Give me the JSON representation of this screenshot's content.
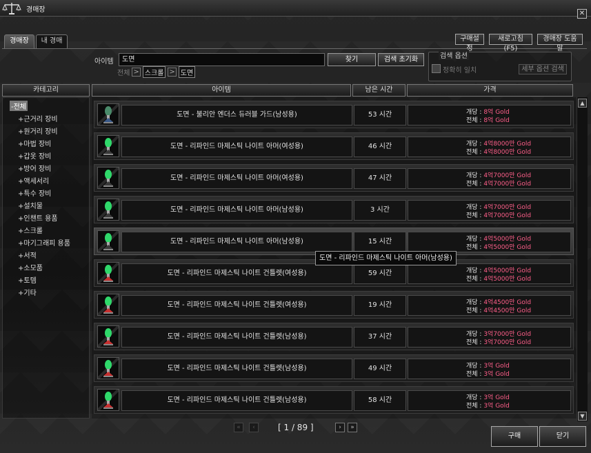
{
  "window": {
    "title": "경매장"
  },
  "tabs": [
    {
      "label": "경매장",
      "active": true
    },
    {
      "label": "내 경매",
      "active": false
    }
  ],
  "toolbar": {
    "purchase_settings": "구매설정",
    "refresh": "새로고침(F5)",
    "help": "경매장 도움말"
  },
  "search": {
    "item_label": "아이템",
    "item_value": "도면",
    "find_button": "찾기",
    "reset_button": "검색 초기화",
    "breadcrumb": [
      "전체",
      "스크롤",
      "도면"
    ],
    "options_title": "검색 옵션",
    "exact_match_label": "정확히 일치",
    "detail_search_button": "세부 옵션 검색"
  },
  "headers": {
    "category": "카테고리",
    "item": "아이템",
    "time_left": "남은 시간",
    "price": "가격"
  },
  "categories": [
    {
      "label": "-전체",
      "selected": true,
      "indent": 0
    },
    {
      "label": "+근거리 장비",
      "indent": 1
    },
    {
      "label": "+원거리 장비",
      "indent": 1
    },
    {
      "label": "+마법 장비",
      "indent": 1
    },
    {
      "label": "+갑옷 장비",
      "indent": 1
    },
    {
      "label": "+방어 장비",
      "indent": 1
    },
    {
      "label": "+액세서리",
      "indent": 1
    },
    {
      "label": "+특수 장비",
      "indent": 1
    },
    {
      "label": "+설치물",
      "indent": 1
    },
    {
      "label": "+인챈트 용품",
      "indent": 1
    },
    {
      "label": "+스크롤",
      "indent": 1
    },
    {
      "label": "+마기그래피 용품",
      "indent": 1
    },
    {
      "label": "+서적",
      "indent": 1
    },
    {
      "label": "+소모품",
      "indent": 1
    },
    {
      "label": "+토템",
      "indent": 1
    },
    {
      "label": "+기타",
      "indent": 1
    }
  ],
  "price_labels": {
    "each": "개당 : ",
    "total": "전체 : "
  },
  "items": [
    {
      "name": "도면 - 불리안 엔더스 듀러블 가드(남성용)",
      "time": "53 시간",
      "each": "8억 Gold",
      "total": "8억 Gold",
      "icon": "blueprint-dark-icon"
    },
    {
      "name": "도면 - 리파인드 마제스틱 나이트 아머(여성용)",
      "time": "46 시간",
      "each": "4억8000만 Gold",
      "total": "4억8000만 Gold",
      "icon": "blueprint-green-icon"
    },
    {
      "name": "도면 - 리파인드 마제스틱 나이트 아머(여성용)",
      "time": "47 시간",
      "each": "4억7000만 Gold",
      "total": "4억7000만 Gold",
      "icon": "blueprint-green-icon"
    },
    {
      "name": "도면 - 리파인드 마제스틱 나이트 아머(남성용)",
      "time": "3 시간",
      "each": "4억7000만 Gold",
      "total": "4억7000만 Gold",
      "icon": "blueprint-green-icon"
    },
    {
      "name": "도면 - 리파인드 마제스틱 나이트 아머(남성용)",
      "time": "15 시간",
      "each": "4억5000만 Gold",
      "total": "4억5000만 Gold",
      "icon": "blueprint-green-icon",
      "highlighted": true
    },
    {
      "name": "도면 - 리파인드 마제스틱 나이트 건틀렛(여성용)",
      "time": "59 시간",
      "each": "4억5000만 Gold",
      "total": "4억5000만 Gold",
      "icon": "blueprint-red-icon"
    },
    {
      "name": "도면 - 리파인드 마제스틱 나이트 건틀렛(여성용)",
      "time": "19 시간",
      "each": "4억4500만 Gold",
      "total": "4억4500만 Gold",
      "icon": "blueprint-red-icon"
    },
    {
      "name": "도면 - 리파인드 마제스틱 나이트 건틀렛(남성용)",
      "time": "37 시간",
      "each": "3억7000만 Gold",
      "total": "3억7000만 Gold",
      "icon": "blueprint-red-icon"
    },
    {
      "name": "도면 - 리파인드 마제스틱 나이트 건틀렛(남성용)",
      "time": "49 시간",
      "each": "3억 Gold",
      "total": "3억 Gold",
      "icon": "blueprint-red-icon"
    },
    {
      "name": "도면 - 리파인드 마제스틱 나이트 건틀렛(남성용)",
      "time": "58 시간",
      "each": "3억 Gold",
      "total": "3억 Gold",
      "icon": "blueprint-red-icon"
    }
  ],
  "tooltip": "도면 - 리파인드 마제스틱 나이트 아머(남성용)",
  "pagination": {
    "text": "[ 1 / 89 ]"
  },
  "footer": {
    "buy": "구매",
    "close": "닫기"
  },
  "colors": {
    "price_accent": "#ff5f8a",
    "highlight_row": "#474747"
  }
}
